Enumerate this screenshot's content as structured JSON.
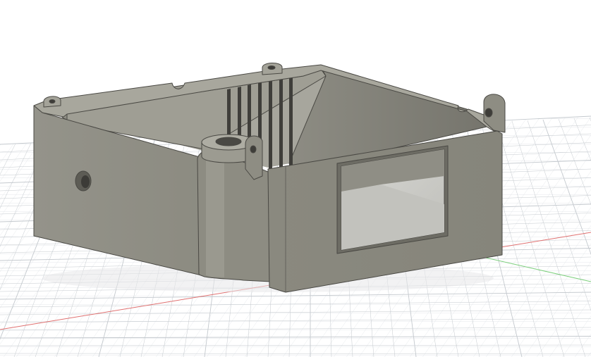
{
  "viewport": {
    "label": "",
    "background_color": "#ffffff"
  },
  "scene": {
    "model": "enclosure-box",
    "grid": {
      "visible": true,
      "line_color": "#d9dde1",
      "major_line_color": "#c4c9ce"
    },
    "axes": {
      "x_axis_color": "#e06a6a",
      "y_axis_color": "#6fc46f"
    },
    "body_colors": {
      "front_face": "#8c8b80",
      "left_face": "#8f8e84",
      "top_rim": "#a9a89e",
      "inner_wall_back": "#9b9a90",
      "inner_wall_right": "#7f7e75",
      "inner_floor": "#b5b4ad",
      "edge_line": "#4a4944",
      "window_interior": "#c9c9c4"
    }
  }
}
